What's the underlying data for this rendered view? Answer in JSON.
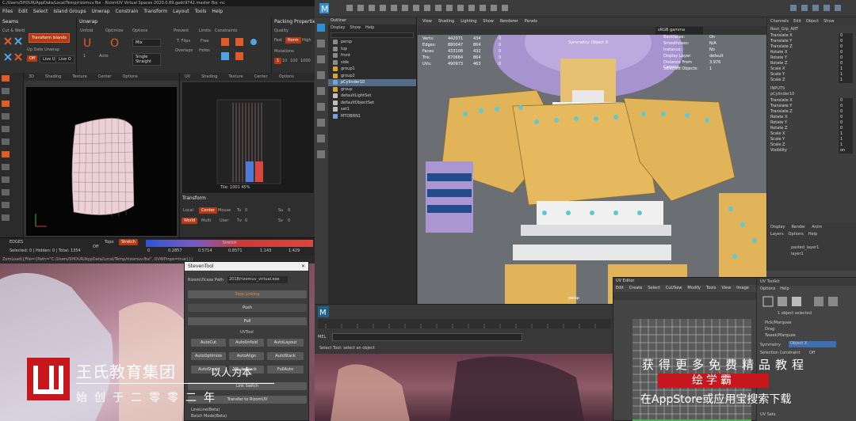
{
  "rizom": {
    "title": "C:/Users/SHOUR/AppData/Local/Temp/rizomuv.fbx - RizomUV  Virtual Spaces 2020.0.89.gadc9742.master fbx -nc",
    "menu": [
      "Files",
      "Edit",
      "Select",
      "Island Groups",
      "Unwrap",
      "Constrain",
      "Transform",
      "Layout",
      "Tools",
      "Help"
    ],
    "seams": {
      "title": "Seams",
      "cut_weld": "Cut & Weld",
      "transform_islands": "Transform Islands",
      "update_label": "Up Date Unwrap",
      "off": "Off",
      "live_u": "Live U",
      "live_o": "Live O"
    },
    "unwrap": {
      "title": "Unwrap",
      "unfold": "Unfold",
      "optimize": "Optimize",
      "options": "Options",
      "prevent": "Prevent",
      "limits": "Limits",
      "constraints": "Constraints",
      "mix": "Mix",
      "t_flips": "T. Flips",
      "free": "Free",
      "overlaps": "Overlaps",
      "holes": "Holes",
      "auto": "Auto",
      "auto_val": "1",
      "single_straight": "Single Straight"
    },
    "packing": {
      "title": "Packing Properties",
      "quality": "Quality",
      "fast": "Fast",
      "norm": "Norm",
      "high": "High",
      "mutations": "Mutations",
      "m1": "1",
      "m2": "10",
      "m3": "100",
      "m4": "1000"
    },
    "view3d": {
      "tabs": [
        "3D",
        "Shading",
        "Texture",
        "Center",
        "Options"
      ]
    },
    "uvview": {
      "tabs": [
        "UV",
        "Shading",
        "Texture",
        "Center",
        "Options"
      ],
      "tile_label": "Tile: 1001 45%"
    },
    "transform": {
      "title": "Transform",
      "local": "Local",
      "center": "Center",
      "mouse": "Mouse",
      "world": "World",
      "multi": "Multi",
      "user": "User",
      "tu": "Tu",
      "tv": "Tv",
      "su": "Su",
      "sv": "Sv",
      "val0": "0",
      "val1": "1"
    },
    "status": {
      "mode": "EDGES",
      "counts": "Selected: 0 | Hidden: 0 | Total: 1354",
      "off": "Off",
      "topo": "Topo",
      "stretch": "Stretch",
      "stretch_title": "Stretch",
      "ticks": [
        "0",
        "0.2857",
        "0.5714",
        "0.8571",
        "1.143",
        "1.429"
      ]
    },
    "cmdline": "ZomLoad({File={Path=\"C:/Users/SHOUR/AppData/Local/Temp/rizomuv.fbx\", UVWProps=true}})"
  },
  "maya": {
    "outliner": {
      "title": "Outliner",
      "menu": [
        "Display",
        "Show",
        "Help"
      ],
      "items": [
        {
          "label": "persp",
          "color": "#8a8a8a",
          "sel": false
        },
        {
          "label": "top",
          "color": "#8a8a8a",
          "sel": false
        },
        {
          "label": "front",
          "color": "#8a8a8a",
          "sel": false
        },
        {
          "label": "side",
          "color": "#8a8a8a",
          "sel": false
        },
        {
          "label": "group1",
          "color": "#d8a43a",
          "sel": false
        },
        {
          "label": "group2",
          "color": "#d8a43a",
          "sel": false
        },
        {
          "label": "pCylinder10",
          "color": "#7aa0d8",
          "sel": true
        },
        {
          "label": "group",
          "color": "#d8a43a",
          "sel": false
        },
        {
          "label": "defaultLightSet",
          "color": "#c0c0c0",
          "sel": false
        },
        {
          "label": "defaultObjectSet",
          "color": "#c0c0c0",
          "sel": false
        },
        {
          "label": "set1",
          "color": "#c0c0c0",
          "sel": false
        },
        {
          "label": "MTOBRN1",
          "color": "#7aa0d8",
          "sel": false
        }
      ]
    },
    "viewport": {
      "menu": [
        "View",
        "Shading",
        "Lighting",
        "Show",
        "Renderer",
        "Panels"
      ],
      "color_space": "sRGB gamma",
      "hud_left": [
        {
          "k": "Verts:",
          "a": "442071",
          "b": "434",
          "c": "0"
        },
        {
          "k": "Edges:",
          "a": "880047",
          "b": "864",
          "c": "0"
        },
        {
          "k": "Faces:",
          "a": "433108",
          "b": "432",
          "c": "0"
        },
        {
          "k": "Tris:",
          "a": "870664",
          "b": "864",
          "c": "0"
        },
        {
          "k": "UVs:",
          "a": "490973",
          "b": "463",
          "c": "0"
        }
      ],
      "symmetry": "Symmetry: Object X",
      "hud_right": [
        {
          "k": "Backfaces:",
          "v": "On"
        },
        {
          "k": "Smoothness:",
          "v": "N/A"
        },
        {
          "k": "Instance:",
          "v": "No"
        },
        {
          "k": "Display Layer:",
          "v": "default"
        },
        {
          "k": "Distance From Camera:",
          "v": "3.976"
        },
        {
          "k": "Selected Objects:",
          "v": "1"
        }
      ],
      "camera_label": "persp"
    },
    "channel_box": {
      "menu": [
        "Channels",
        "Edit",
        "Object",
        "Show"
      ],
      "object": "Root_Grp_ART",
      "rows": [
        {
          "k": "Translate X",
          "v": "0"
        },
        {
          "k": "Translate Y",
          "v": "0"
        },
        {
          "k": "Translate Z",
          "v": "0"
        },
        {
          "k": "Rotate X",
          "v": "0"
        },
        {
          "k": "Rotate Y",
          "v": "0"
        },
        {
          "k": "Rotate Z",
          "v": "0"
        },
        {
          "k": "Scale X",
          "v": "1"
        },
        {
          "k": "Scale Y",
          "v": "1"
        },
        {
          "k": "Scale Z",
          "v": "1"
        }
      ],
      "inputs_title": "INPUTS",
      "input_node": "pCylinder10",
      "rows2": [
        {
          "k": "Translate X",
          "v": "0"
        },
        {
          "k": "Translate Y",
          "v": "0"
        },
        {
          "k": "Translate Z",
          "v": "0"
        },
        {
          "k": "Rotate X",
          "v": "0"
        },
        {
          "k": "Rotate Y",
          "v": "0"
        },
        {
          "k": "Rotate Z",
          "v": "0"
        },
        {
          "k": "Scale X",
          "v": "1"
        },
        {
          "k": "Scale Y",
          "v": "1"
        },
        {
          "k": "Scale Z",
          "v": "1"
        },
        {
          "k": "Visibility",
          "v": "on"
        }
      ]
    },
    "layers": {
      "tabs": [
        "Display",
        "Render",
        "Anim"
      ],
      "menu": [
        "Layers",
        "Options",
        "Help"
      ],
      "items": [
        "pasted_layer1",
        "layer1"
      ]
    },
    "mel_label": "MEL",
    "help_line": "Select Tool: select an object"
  },
  "uv_editor": {
    "title": "UV Editor",
    "menu": [
      "Edit",
      "Create",
      "Select",
      "Cut/Sew",
      "Modify",
      "Tools",
      "View",
      "Image"
    ],
    "toolkit_title": "UV Toolkit",
    "toolkit_menu": [
      "Options",
      "Help"
    ],
    "selected_info": "1 object selected",
    "radio": [
      "Pick/Marquee",
      "Drag",
      "Tweak/Marquee"
    ],
    "symmetry": "Symmetry",
    "symmetry_val": "Object X",
    "section": "Selection Constraint",
    "off": "Off",
    "uv_sets": "UV Sets"
  },
  "stevan": {
    "title": "StevenTool",
    "path_label": "RizomUV.exe Path",
    "path_value": "2018/rizomuv_virtual.exe",
    "stop_linking": "Stop Linking",
    "push": "Push",
    "pull": "Pull",
    "uvtool": "UVTool",
    "buttons": [
      "AutoCut",
      "AutoUnfold",
      "AutoLayout",
      "AutoOptimize",
      "AutoAlign",
      "AutoStack",
      "AutoStack",
      "AutoStack",
      "FullAuto"
    ],
    "link_switch": "Link Switch",
    "transfer": "Transfer to RizomUV",
    "options": [
      "LineLine(Beta)",
      "Batch Mode(Beta)"
    ]
  },
  "branding": {
    "company": "王氏教育集团",
    "slogan": "以人为本",
    "founded": "始创于二零零二年",
    "promo_line1": "获得更多免费精品教程",
    "promo_app": "绘学霸",
    "promo_line2": "在AppStore或应用宝搜索下载",
    "colors": {
      "brand_red": "#c8161d",
      "rizom_orange": "#b33a14",
      "maya_select": "#546b8a"
    }
  }
}
